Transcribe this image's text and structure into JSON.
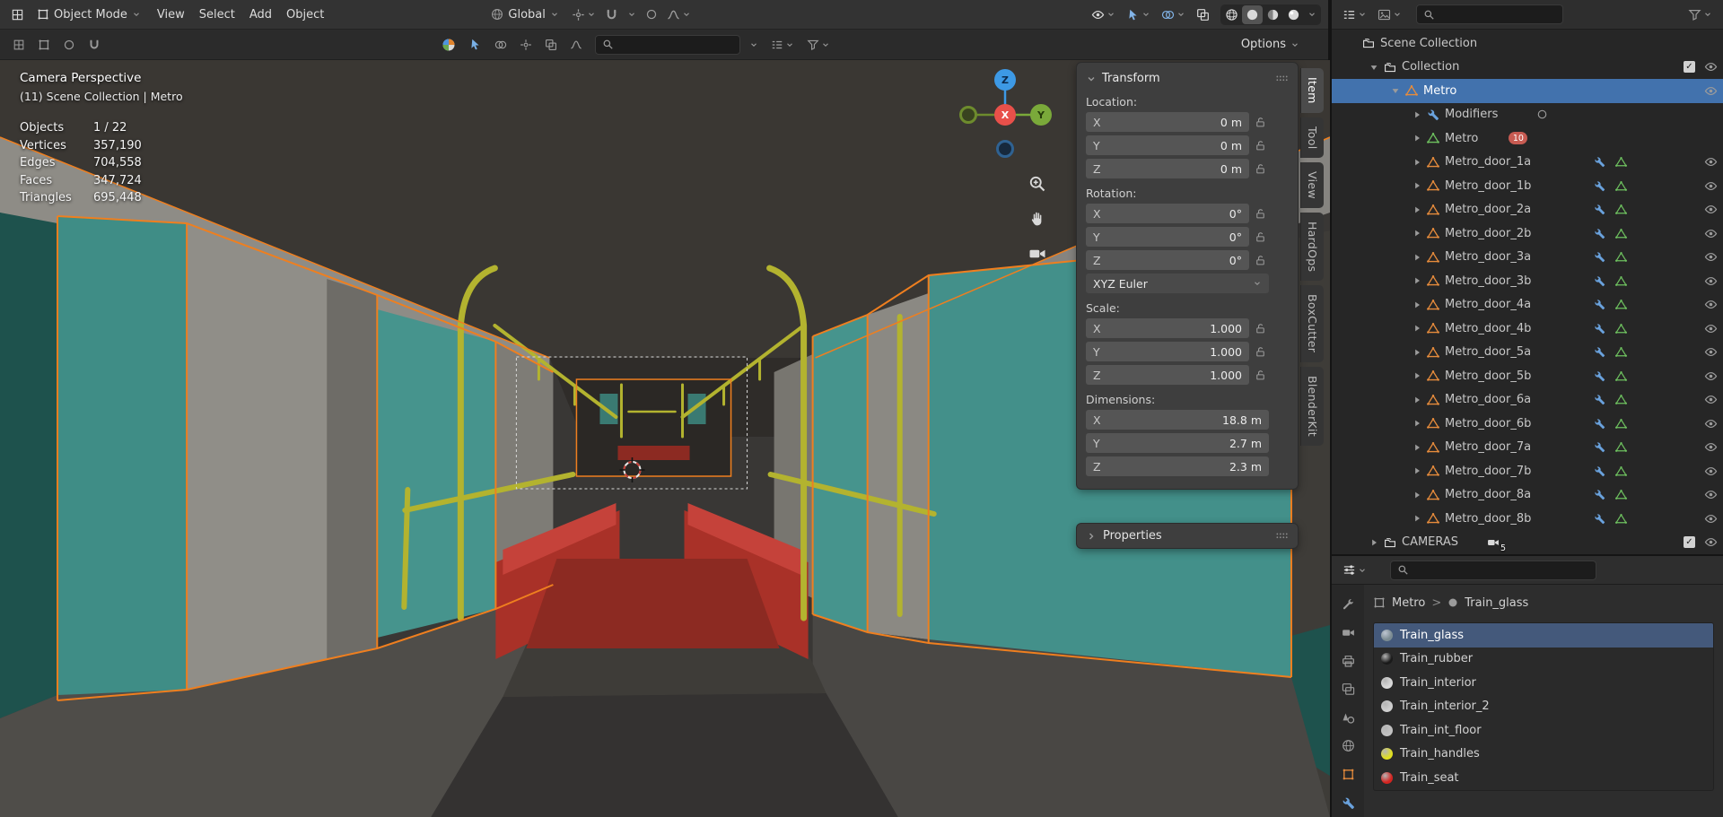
{
  "colors": {
    "selection_highlight": "#4272ad",
    "object_icon_orange": "#e78c3c",
    "mesh_data_green": "#6ec15f",
    "modifier_blue": "#6aa2dd",
    "selected_outline_orange": "#ef7f1f",
    "axis_x": "#e8504a",
    "axis_y": "#7aa93a",
    "axis_z": "#3d99e5"
  },
  "topbar": {
    "mode_label": "Object Mode",
    "menus": [
      "View",
      "Select",
      "Add",
      "Object"
    ],
    "orientation_label": "Global",
    "view_toggles": [
      "visibility",
      "gizmos",
      "overlays",
      "xray"
    ],
    "shading_modes": [
      "wireframe",
      "solid",
      "material",
      "rendered"
    ],
    "active_shading": "solid"
  },
  "toolbar": {
    "options_label": "Options"
  },
  "viewport": {
    "view_label": "Camera Perspective",
    "context_label": "(11) Scene Collection | Metro",
    "stats": [
      {
        "label": "Objects",
        "value": "1 / 22"
      },
      {
        "label": "Vertices",
        "value": "357,190"
      },
      {
        "label": "Edges",
        "value": "704,558"
      },
      {
        "label": "Faces",
        "value": "347,724"
      },
      {
        "label": "Triangles",
        "value": "695,448"
      }
    ],
    "gizmo": {
      "up": "Z",
      "right": "Y",
      "center": "X"
    },
    "nav_tools": [
      "zoom",
      "pan",
      "camera"
    ],
    "sidebar_tabs": [
      {
        "label": "Item",
        "active": true
      },
      {
        "label": "Tool",
        "active": false
      },
      {
        "label": "View",
        "active": false
      },
      {
        "label": "HardOps",
        "active": false
      },
      {
        "label": "BoxCutter",
        "active": false
      },
      {
        "label": "BlenderKit",
        "active": false
      }
    ]
  },
  "transform_panel": {
    "title": "Transform",
    "groups": [
      {
        "label": "Location:",
        "lock": true,
        "rows": [
          {
            "axis": "X",
            "value": "0 m"
          },
          {
            "axis": "Y",
            "value": "0 m"
          },
          {
            "axis": "Z",
            "value": "0 m"
          }
        ]
      },
      {
        "label": "Rotation:",
        "lock": true,
        "dropdown_after": "XYZ Euler",
        "rows": [
          {
            "axis": "X",
            "value": "0°"
          },
          {
            "axis": "Y",
            "value": "0°"
          },
          {
            "axis": "Z",
            "value": "0°"
          }
        ]
      },
      {
        "label": "Scale:",
        "lock": true,
        "rows": [
          {
            "axis": "X",
            "value": "1.000"
          },
          {
            "axis": "Y",
            "value": "1.000"
          },
          {
            "axis": "Z",
            "value": "1.000"
          }
        ]
      },
      {
        "label": "Dimensions:",
        "lock": false,
        "rows": [
          {
            "axis": "X",
            "value": "18.8 m"
          },
          {
            "axis": "Y",
            "value": "2.7 m"
          },
          {
            "axis": "Z",
            "value": "2.3 m"
          }
        ]
      }
    ],
    "collapsed_label": "Properties"
  },
  "outliner": {
    "rows": [
      {
        "label": "Scene Collection",
        "depth": 0,
        "icon": "collection",
        "arrow": "none"
      },
      {
        "label": "Collection",
        "depth": 1,
        "icon": "collection",
        "arrow": "down",
        "checkbox": true,
        "eye": true
      },
      {
        "label": "Metro",
        "depth": 2,
        "icon": "mesh-object",
        "arrow": "down",
        "selected": true,
        "eye": true
      },
      {
        "label": "Modifiers",
        "depth": 3,
        "icon": "wrench",
        "arrow": "right",
        "trail": [
          "circle"
        ]
      },
      {
        "label": "Metro",
        "depth": 3,
        "icon": "mesh-data",
        "arrow": "right",
        "badge": "10"
      },
      {
        "label": "Metro_door_1a",
        "depth": 3,
        "icon": "mesh-object",
        "arrow": "right",
        "trail": [
          "wrench",
          "mesh-data"
        ],
        "eye": true
      },
      {
        "label": "Metro_door_1b",
        "depth": 3,
        "icon": "mesh-object",
        "arrow": "right",
        "trail": [
          "wrench",
          "mesh-data"
        ],
        "eye": true
      },
      {
        "label": "Metro_door_2a",
        "depth": 3,
        "icon": "mesh-object",
        "arrow": "right",
        "trail": [
          "wrench",
          "mesh-data"
        ],
        "eye": true
      },
      {
        "label": "Metro_door_2b",
        "depth": 3,
        "icon": "mesh-object",
        "arrow": "right",
        "trail": [
          "wrench",
          "mesh-data"
        ],
        "eye": true
      },
      {
        "label": "Metro_door_3a",
        "depth": 3,
        "icon": "mesh-object",
        "arrow": "right",
        "trail": [
          "wrench",
          "mesh-data"
        ],
        "eye": true
      },
      {
        "label": "Metro_door_3b",
        "depth": 3,
        "icon": "mesh-object",
        "arrow": "right",
        "trail": [
          "wrench",
          "mesh-data"
        ],
        "eye": true
      },
      {
        "label": "Metro_door_4a",
        "depth": 3,
        "icon": "mesh-object",
        "arrow": "right",
        "trail": [
          "wrench",
          "mesh-data"
        ],
        "eye": true
      },
      {
        "label": "Metro_door_4b",
        "depth": 3,
        "icon": "mesh-object",
        "arrow": "right",
        "trail": [
          "wrench",
          "mesh-data"
        ],
        "eye": true
      },
      {
        "label": "Metro_door_5a",
        "depth": 3,
        "icon": "mesh-object",
        "arrow": "right",
        "trail": [
          "wrench",
          "mesh-data"
        ],
        "eye": true
      },
      {
        "label": "Metro_door_5b",
        "depth": 3,
        "icon": "mesh-object",
        "arrow": "right",
        "trail": [
          "wrench",
          "mesh-data"
        ],
        "eye": true
      },
      {
        "label": "Metro_door_6a",
        "depth": 3,
        "icon": "mesh-object",
        "arrow": "right",
        "trail": [
          "wrench",
          "mesh-data"
        ],
        "eye": true
      },
      {
        "label": "Metro_door_6b",
        "depth": 3,
        "icon": "mesh-object",
        "arrow": "right",
        "trail": [
          "wrench",
          "mesh-data"
        ],
        "eye": true
      },
      {
        "label": "Metro_door_7a",
        "depth": 3,
        "icon": "mesh-object",
        "arrow": "right",
        "trail": [
          "wrench",
          "mesh-data"
        ],
        "eye": true
      },
      {
        "label": "Metro_door_7b",
        "depth": 3,
        "icon": "mesh-object",
        "arrow": "right",
        "trail": [
          "wrench",
          "mesh-data"
        ],
        "eye": true
      },
      {
        "label": "Metro_door_8a",
        "depth": 3,
        "icon": "mesh-object",
        "arrow": "right",
        "trail": [
          "wrench",
          "mesh-data"
        ],
        "eye": true
      },
      {
        "label": "Metro_door_8b",
        "depth": 3,
        "icon": "mesh-object",
        "arrow": "right",
        "trail": [
          "wrench",
          "mesh-data"
        ],
        "eye": true
      },
      {
        "label": "CAMERAS",
        "depth": 1,
        "icon": "collection",
        "arrow": "right",
        "camera_badge": "5",
        "checkbox": true,
        "eye": true
      }
    ]
  },
  "properties": {
    "breadcrumb": [
      {
        "icon": "object",
        "label": "Metro"
      },
      {
        "icon": "material",
        "label": "Train_glass"
      }
    ],
    "tabs": [
      "tool",
      "render",
      "output",
      "view-layer",
      "scene",
      "world",
      "object",
      "modifiers"
    ],
    "materials": [
      {
        "name": "Train_glass",
        "color": "#7b8b92",
        "selected": true
      },
      {
        "name": "Train_rubber",
        "color": "#1a1a1a",
        "selected": false
      },
      {
        "name": "Train_interior",
        "color": "#d9d9d9",
        "selected": false
      },
      {
        "name": "Train_interior_2",
        "color": "#cfcfcf",
        "selected": false
      },
      {
        "name": "Train_int_floor",
        "color": "#c2c2c2",
        "selected": false
      },
      {
        "name": "Train_handles",
        "color": "#e0df20",
        "selected": false
      },
      {
        "name": "Train_seat",
        "color": "#d42420",
        "selected": false
      }
    ]
  }
}
